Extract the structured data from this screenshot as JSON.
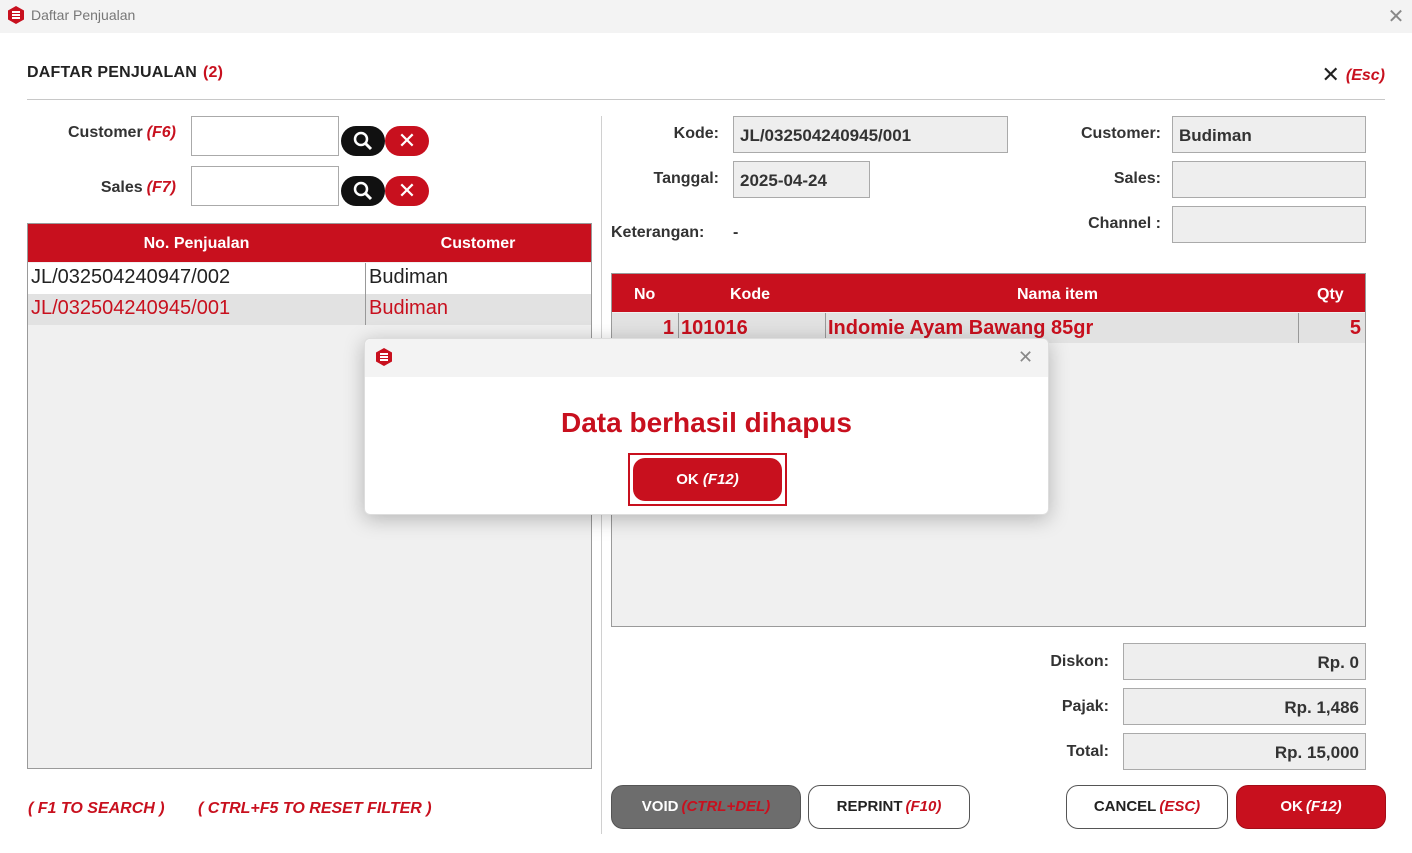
{
  "window": {
    "title": "Daftar Penjualan",
    "close_glyph": "✕"
  },
  "header": {
    "title": "DAFTAR PENJUALAN",
    "count": "(2)",
    "close_glyph": "✕",
    "close_key": "(Esc)"
  },
  "filters": {
    "customer_label": "Customer",
    "customer_key": "(F6)",
    "customer_value": "",
    "sales_label": "Sales",
    "sales_key": "(F7)",
    "sales_value": "",
    "clear_glyph": "✕"
  },
  "list": {
    "columns": [
      "No. Penjualan",
      "Customer"
    ],
    "rows": [
      {
        "no": "JL/032504240947/002",
        "customer": "Budiman",
        "selected": false
      },
      {
        "no": "JL/032504240945/001",
        "customer": "Budiman",
        "selected": true
      }
    ]
  },
  "detail": {
    "kode_label": "Kode:",
    "kode_value": "JL/032504240945/001",
    "tanggal_label": "Tanggal:",
    "tanggal_value": "2025-04-24",
    "keterangan_label": "Keterangan:",
    "keterangan_value": "-",
    "customer_label": "Customer:",
    "customer_value": "Budiman",
    "sales_label": "Sales:",
    "sales_value": "",
    "channel_label": "Channel :",
    "channel_value": ""
  },
  "items": {
    "columns": [
      "No",
      "Kode",
      "Nama item",
      "Qty"
    ],
    "rows": [
      {
        "no": "1",
        "kode": "101016",
        "nama": "Indomie Ayam Bawang 85gr",
        "qty": "5"
      }
    ]
  },
  "totals": {
    "diskon_label": "Diskon:",
    "diskon_value": "Rp. 0",
    "pajak_label": "Pajak:",
    "pajak_value": "Rp. 1,486",
    "total_label": "Total:",
    "total_value": "Rp. 15,000"
  },
  "hints": {
    "search": "( F1 TO SEARCH )",
    "reset": "( CTRL+F5 TO RESET FILTER )"
  },
  "buttons": {
    "void_label": "VOID",
    "void_key": "(CTRL+DEL)",
    "reprint_label": "REPRINT",
    "reprint_key": "(F10)",
    "cancel_label": "CANCEL",
    "cancel_key": "(ESC)",
    "ok_label": "OK",
    "ok_key": "(F12)"
  },
  "dialog": {
    "message": "Data berhasil dihapus",
    "close_glyph": "✕",
    "ok_label": "OK",
    "ok_key": "(F12)"
  },
  "colors": {
    "accent": "#c8101e",
    "selected_row": "#e2e2e2",
    "panel_bg": "#f0f0f0"
  }
}
